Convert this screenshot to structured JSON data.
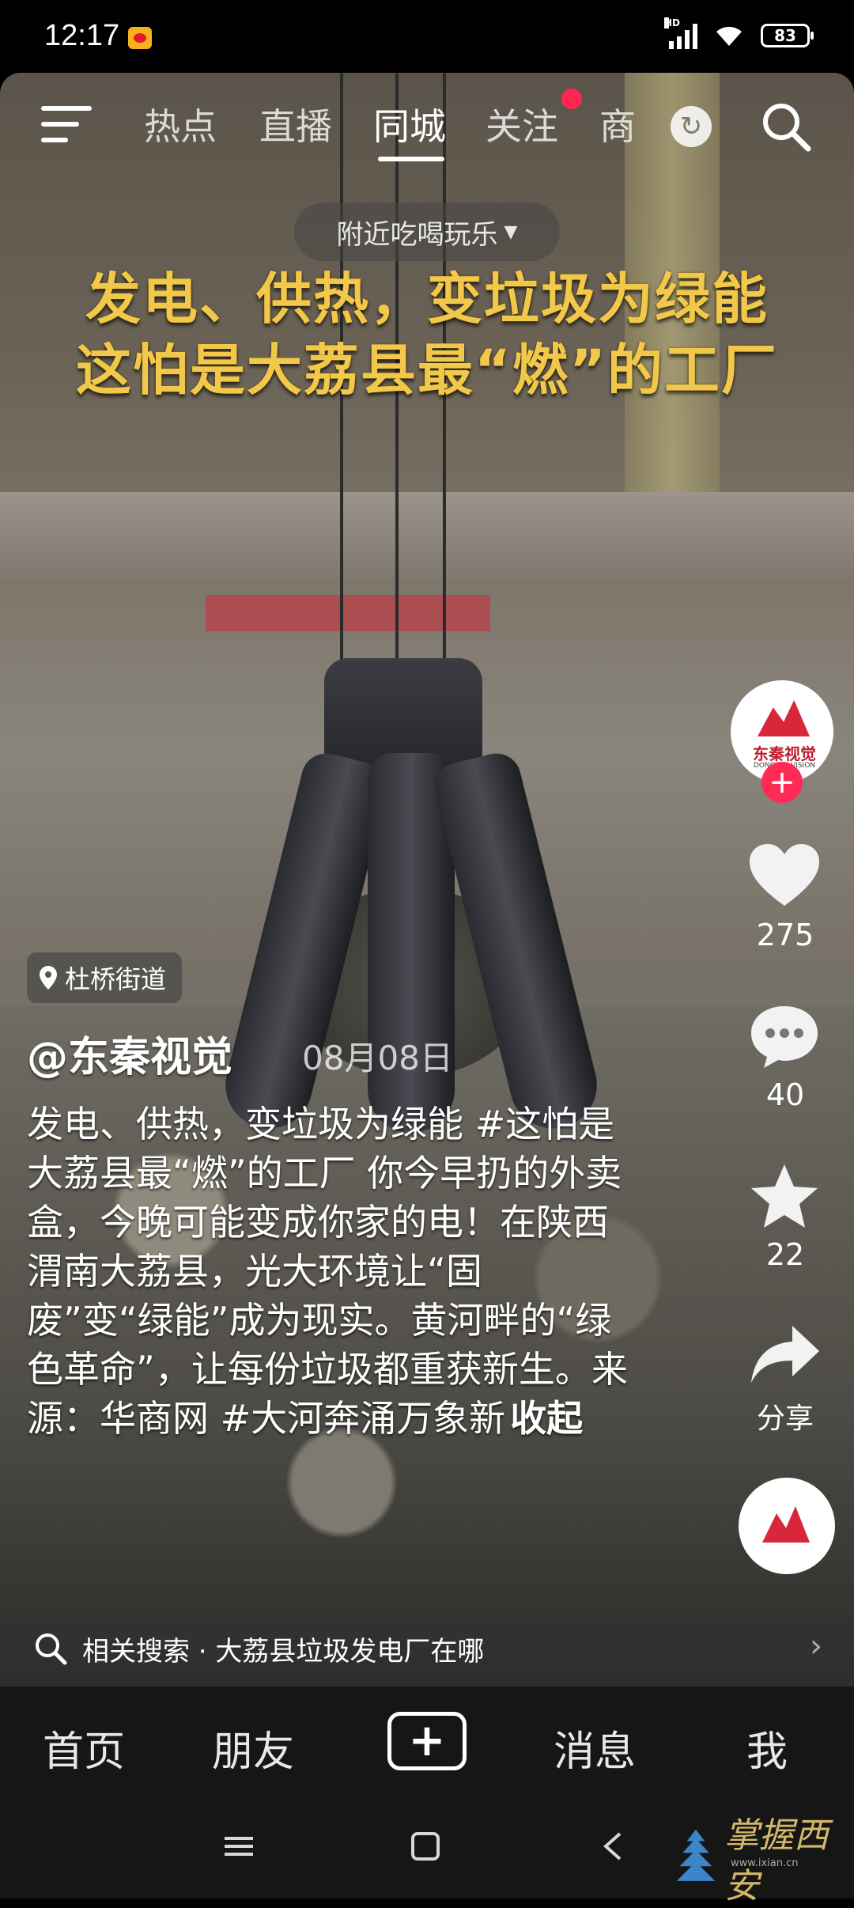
{
  "status_bar": {
    "time": "12:17",
    "network": "HD",
    "battery": "83"
  },
  "top_tabs": [
    "热点",
    "直播",
    "同城",
    "关注",
    "商"
  ],
  "active_tab": "同城",
  "nearby_filter": "附近吃喝玩乐",
  "headline_line1": "发电、供热，变垃圾为绿能",
  "headline_line2": "这怕是大荔县最“燃”的工厂",
  "author_avatar_text": "东秦视觉",
  "author_avatar_sub": "DONGQIN VISION",
  "actions": {
    "likes": "275",
    "comments": "40",
    "favorites": "22",
    "share_label": "分享"
  },
  "location": "杜桥街道",
  "author": "@东秦视觉",
  "post_date": "08月08日",
  "caption": "发电、供热，变垃圾为绿能 #这怕是大荔县最“燃”的工厂 你今早扔的外卖盒，今晚可能变成你家的电！在陕西渭南大荔县，光大环境让“固废”变“绿能”成为现实。黄河畔的“绿色革命”，让每份垃圾都重获新生。来源：华商网 #大河奔涌万象新",
  "caption_toggle": "收起",
  "related_search": "相关搜索 · 大荔县垃圾发电厂在哪",
  "bottom_nav": {
    "home": "首页",
    "friends": "朋友",
    "messages": "消息",
    "me": "我"
  },
  "watermark": "掌握西安",
  "watermark_url": "www.ixian.cn",
  "colors": {
    "headline": "#f1c84a",
    "accent": "#fe2c55",
    "avatar_brand": "#d8263b"
  }
}
